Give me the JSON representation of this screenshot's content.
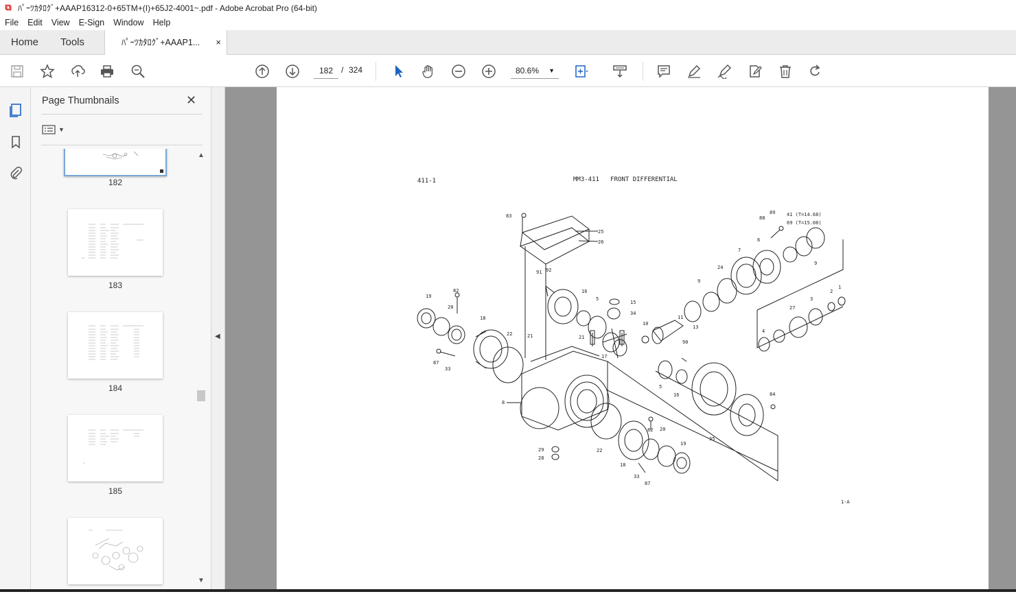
{
  "window": {
    "title": "ﾊﾟｰﾂｶﾀﾛｸﾞ+AAAP16312-0+65TM+(I)+65J2-4001~.pdf - Adobe Acrobat Pro (64-bit)"
  },
  "menu": [
    "File",
    "Edit",
    "View",
    "E-Sign",
    "Window",
    "Help"
  ],
  "tabs": {
    "home": "Home",
    "tools": "Tools",
    "document": "ﾊﾟｰﾂｶﾀﾛｸﾞ+AAAP1...",
    "close": "×"
  },
  "toolbar": {
    "current_page": "182",
    "page_separator": "/",
    "total_pages": "324",
    "zoom": "80.6%"
  },
  "icons": {
    "save": "save-icon",
    "bookmark_star": "star-icon",
    "share": "upload-icon",
    "print": "print-icon",
    "search": "zoom-search-icon",
    "prev": "page-up-icon",
    "next": "page-down-icon",
    "select": "cursor-icon",
    "hand": "hand-icon",
    "zoom_out": "zoom-out-icon",
    "zoom_in": "zoom-in-icon",
    "fit": "fit-page-icon",
    "scroll": "scroll-mode-icon",
    "comment": "comment-icon",
    "highlight": "pen-icon",
    "sign": "sign-icon",
    "edit": "edit-icon",
    "delete": "trash-icon",
    "rotate": "rotate-icon"
  },
  "panel": {
    "title": "Page Thumbnails",
    "close": "✕",
    "thumbnails": [
      {
        "label": "182"
      },
      {
        "label": "183"
      },
      {
        "label": "184"
      },
      {
        "label": "185"
      },
      {
        "label": ""
      }
    ]
  },
  "document": {
    "header_left": "411-1",
    "header_center": "MM3-411   FRONT DIFFERENTIAL",
    "footer_right": "1-A",
    "callouts": {
      "83": "83",
      "25": "25",
      "26": "26",
      "89": "89",
      "88": "88",
      "41": "41 (T=14.68)",
      "69": "69 (T=15.08)",
      "7": "7",
      "6": "6",
      "9": "9",
      "24": "24",
      "1": "1",
      "2": "2",
      "3": "3",
      "27": "27",
      "4": "4",
      "16": "16",
      "15": "15",
      "34": "34",
      "5": "5",
      "10": "10",
      "11": "11",
      "13": "13",
      "90": "90",
      "91": "91",
      "92": "92",
      "19": "19",
      "82": "82",
      "20": "20",
      "18": "18",
      "22": "22",
      "21": "21",
      "87": "87",
      "33": "33",
      "17": "17",
      "8": "8",
      "29": "29",
      "28": "28",
      "35": "35",
      "84": "84"
    }
  }
}
